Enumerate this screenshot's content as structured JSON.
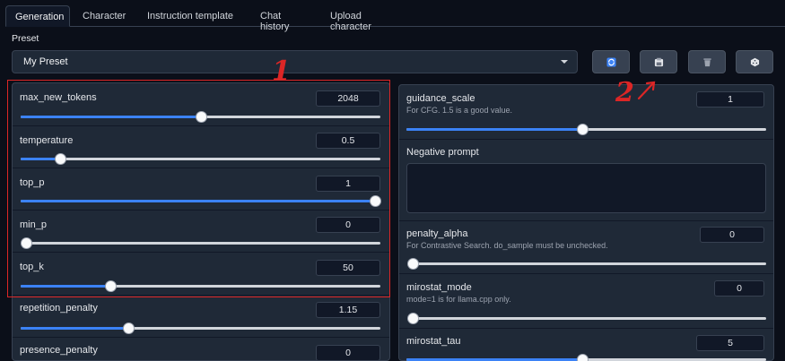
{
  "tabs": [
    "Generation",
    "Character",
    "Instruction template",
    "Chat history",
    "Upload character"
  ],
  "preset": {
    "label": "Preset",
    "value": "My Preset",
    "buttons": [
      "refresh-icon",
      "save-icon",
      "delete-icon",
      "random-icon"
    ]
  },
  "left_sliders": [
    {
      "name": "max_new_tokens",
      "value": "2048",
      "fraction": 0.5
    },
    {
      "name": "temperature",
      "value": "0.5",
      "fraction": 0.11
    },
    {
      "name": "top_p",
      "value": "1",
      "fraction": 1.0
    },
    {
      "name": "min_p",
      "value": "0",
      "fraction": 0.0
    },
    {
      "name": "top_k",
      "value": "50",
      "fraction": 0.25
    },
    {
      "name": "repetition_penalty",
      "value": "1.15",
      "fraction": 0.3
    },
    {
      "name": "presence_penalty",
      "value": "0",
      "fraction": 0.0
    }
  ],
  "right": {
    "guidance_scale": {
      "name": "guidance_scale",
      "info": "For CFG. 1.5 is a good value.",
      "value": "1",
      "fraction": 0.49
    },
    "negative_prompt": {
      "label": "Negative prompt"
    },
    "penalty_alpha": {
      "name": "penalty_alpha",
      "info": "For Contrastive Search. do_sample must be unchecked.",
      "value": "0",
      "fraction": 0.0
    },
    "mirostat_mode": {
      "name": "mirostat_mode",
      "info": "mode=1 is for llama.cpp only.",
      "value": "0",
      "fraction": 0.0
    },
    "mirostat_tau": {
      "name": "mirostat_tau",
      "value": "5",
      "fraction": 0.49
    }
  },
  "annotations": [
    "1",
    "2"
  ],
  "colors": {
    "background": "#0b0f19",
    "panel": "#1f2937",
    "accent": "#3b82f6",
    "highlight": "#dc2626"
  }
}
